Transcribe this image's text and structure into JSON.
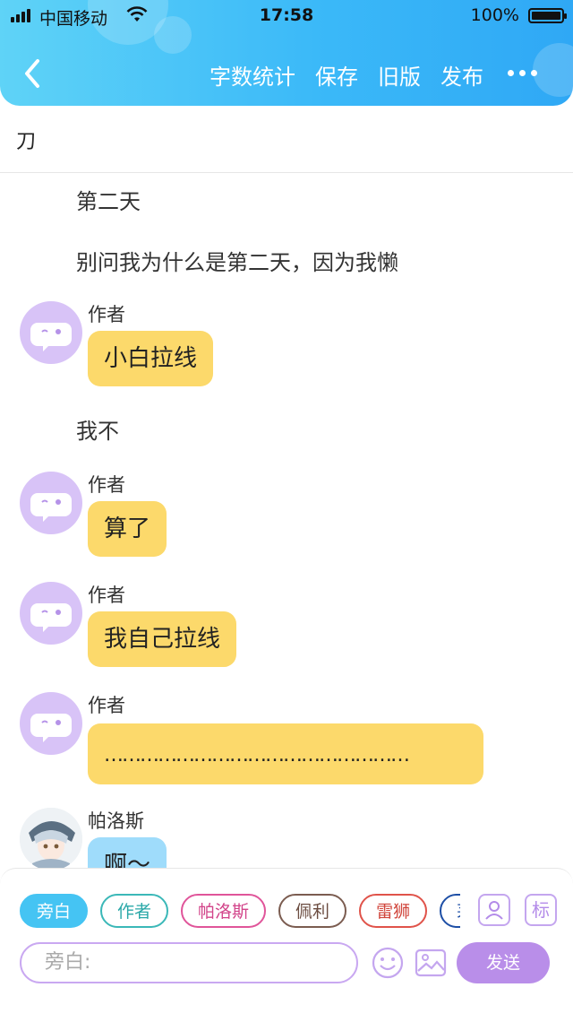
{
  "status_bar": {
    "carrier": "中国移动",
    "time": "17:58",
    "battery_percent": "100%"
  },
  "nav": {
    "actions": [
      "字数统计",
      "保存",
      "旧版",
      "发布"
    ]
  },
  "title": "刀",
  "messages": [
    {
      "type": "narration",
      "text": "第二天"
    },
    {
      "type": "narration",
      "text": "别问我为什么是第二天，因为我懒"
    },
    {
      "type": "dialogue",
      "speaker": "作者",
      "text": "小白拉线"
    },
    {
      "type": "narration",
      "text": "我不"
    },
    {
      "type": "dialogue",
      "speaker": "作者",
      "text": "算了"
    },
    {
      "type": "dialogue",
      "speaker": "作者",
      "text": "我自己拉线"
    },
    {
      "type": "dialogue",
      "speaker": "作者",
      "text": "……………………………………………"
    },
    {
      "type": "dialogue",
      "speaker": "帕洛斯",
      "text": "啊～"
    }
  ],
  "composer": {
    "roles": [
      "旁白",
      "作者",
      "帕洛斯",
      "佩利",
      "雷狮",
      "茅"
    ],
    "selected_role": "旁白",
    "tag_button_label": "标",
    "input_placeholder": "旁白:",
    "send_label": "发送"
  },
  "colors": {
    "header_gradient_start": "#5fd3f7",
    "header_gradient_end": "#2fa8f5",
    "bubble_author": "#fcd96b",
    "bubble_character": "#9fdcfb",
    "accent_purple": "#b98ee9"
  }
}
